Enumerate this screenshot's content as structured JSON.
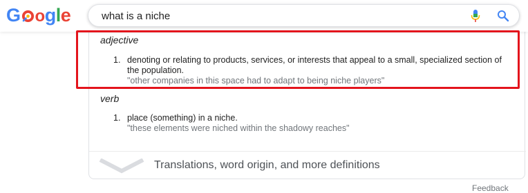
{
  "logo": {
    "letters": [
      "G",
      "o",
      "g",
      "l",
      "e"
    ],
    "colors": {
      "blue": "#4285f4",
      "red": "#ea4335",
      "yellow": "#fbbc05",
      "green": "#34a853"
    }
  },
  "search": {
    "query": "what is a niche",
    "mic_icon": "microphone-icon",
    "search_icon": "magnifier-icon"
  },
  "definitions": [
    {
      "part_of_speech": "adjective",
      "senses": [
        {
          "number": "1.",
          "definition": "denoting or relating to products, services, or interests that appeal to a small, specialized section of the population.",
          "example": "\"other companies in this space had to adapt to being niche players\""
        }
      ]
    },
    {
      "part_of_speech": "verb",
      "senses": [
        {
          "number": "1.",
          "definition": "place (something) in a niche.",
          "example": "\"these elements were niched within the shadowy reaches\""
        }
      ]
    }
  ],
  "more_link": "Translations, word origin, and more definitions",
  "feedback": "Feedback",
  "highlight_color": "#e3141c"
}
